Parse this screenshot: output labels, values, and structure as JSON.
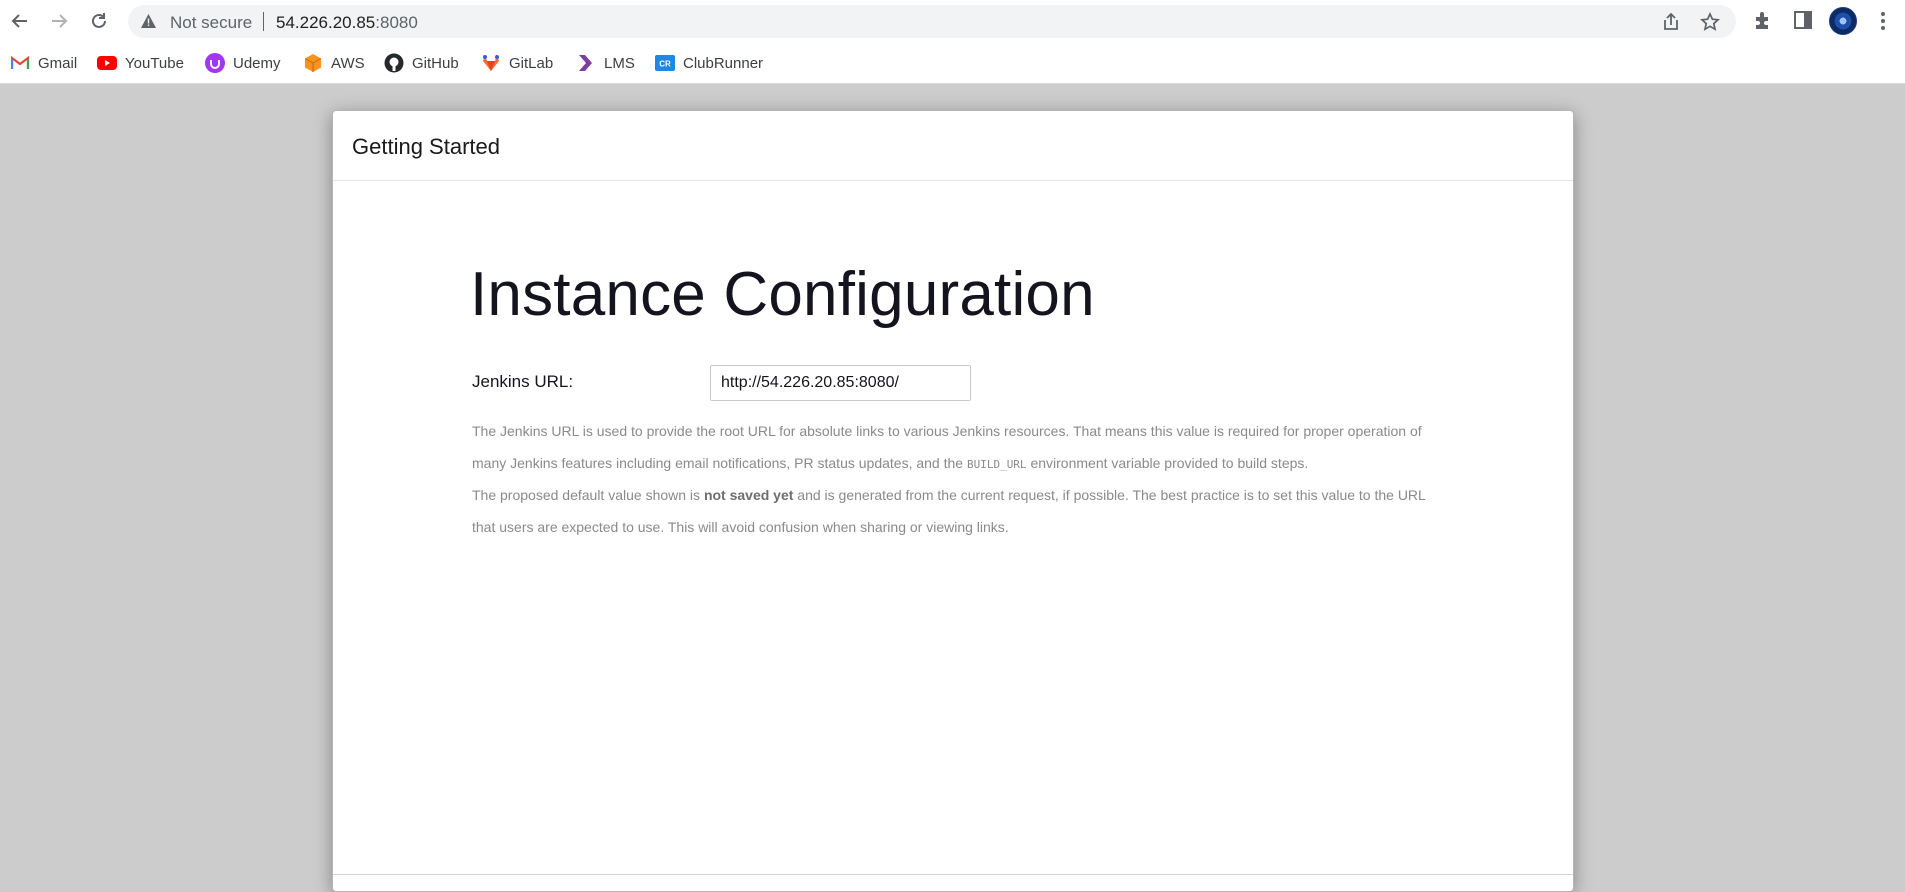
{
  "browser": {
    "security_label": "Not secure",
    "url_host": "54.226.20.85",
    "url_port": ":8080"
  },
  "bookmarks": [
    {
      "label": "Gmail",
      "icon": "gmail-icon"
    },
    {
      "label": "YouTube",
      "icon": "youtube-icon"
    },
    {
      "label": "Udemy",
      "icon": "udemy-icon"
    },
    {
      "label": "AWS",
      "icon": "aws-icon"
    },
    {
      "label": "GitHub",
      "icon": "github-icon"
    },
    {
      "label": "GitLab",
      "icon": "gitlab-icon"
    },
    {
      "label": "LMS",
      "icon": "lms-icon"
    },
    {
      "label": "ClubRunner",
      "icon": "clubrunner-icon"
    }
  ],
  "page": {
    "panel_title": "Getting Started",
    "heading": "Instance Configuration",
    "jenkins_url_label": "Jenkins URL:",
    "jenkins_url_value": "http://54.226.20.85:8080/",
    "help_p1_a": "The Jenkins URL is used to provide the root URL for absolute links to various Jenkins resources. That means this value is required for proper operation of many Jenkins features including email notifications, PR status updates, and the ",
    "help_p1_code": "BUILD_URL",
    "help_p1_b": " environment variable provided to build steps.",
    "help_p2_a": "The proposed default value shown is ",
    "help_p2_bold": "not saved yet",
    "help_p2_b": " and is generated from the current request, if possible. The best practice is to set this value to the URL that users are expected to use. This will avoid confusion when sharing or viewing links."
  },
  "colors": {
    "page_background": "#cccccc",
    "omnibox": "#f1f3f4",
    "heading_text": "#14141f",
    "help_text": "#8a8a8a"
  }
}
